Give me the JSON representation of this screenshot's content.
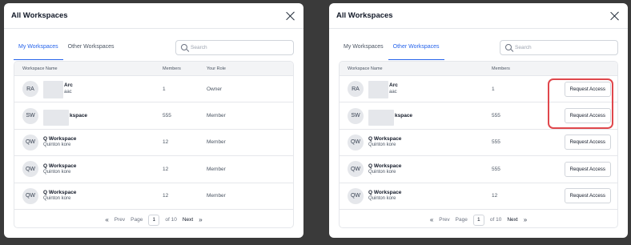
{
  "left": {
    "title": "All Workspaces",
    "tabs": [
      {
        "label": "My Workspaces",
        "active": true
      },
      {
        "label": "Other Workspaces",
        "active": false
      }
    ],
    "search_placeholder": "Search",
    "columns": [
      "Workspace Name",
      "Members",
      "Your Role"
    ],
    "rows": [
      {
        "initials": "RA",
        "name": "Arc",
        "owner": "aac",
        "members": "1",
        "role": "Owner"
      },
      {
        "initials": "SW",
        "name": "kspace",
        "owner": "",
        "members": "555",
        "role": "Member"
      },
      {
        "initials": "QW",
        "name": "Q Workspace",
        "owner": "Quinton kore",
        "members": "12",
        "role": "Member"
      },
      {
        "initials": "QW",
        "name": "Q Workspace",
        "owner": "Quinton kore",
        "members": "12",
        "role": "Member"
      },
      {
        "initials": "QW",
        "name": "Q Workspace",
        "owner": "Quinton kore",
        "members": "12",
        "role": "Member"
      }
    ],
    "pager": {
      "prev": "Prev",
      "page_label": "Page",
      "page": "1",
      "of": "of 10",
      "next": "Next"
    }
  },
  "right": {
    "title": "All Workspaces",
    "tabs": [
      {
        "label": "My Workspaces",
        "active": false
      },
      {
        "label": "Other Workspaces",
        "active": true
      }
    ],
    "search_placeholder": "Search",
    "columns": [
      "Workspace Name",
      "Members"
    ],
    "action_label": "Request Access",
    "rows": [
      {
        "initials": "RA",
        "name": "Arc",
        "owner": "aac",
        "members": "1"
      },
      {
        "initials": "SW",
        "name": "kspace",
        "owner": "",
        "members": "555"
      },
      {
        "initials": "QW",
        "name": "Q Workspace",
        "owner": "Quinton kore",
        "members": "555"
      },
      {
        "initials": "QW",
        "name": "Q Workspace",
        "owner": "Quinton kore",
        "members": "555"
      },
      {
        "initials": "QW",
        "name": "Q Workspace",
        "owner": "Quinton kore",
        "members": "12"
      }
    ],
    "pager": {
      "prev": "Prev",
      "page_label": "Page",
      "page": "1",
      "of": "of 10",
      "next": "Next"
    }
  },
  "colors": {
    "accent": "#2563eb",
    "highlight": "#e0474c",
    "backdrop": "#3a3a3a"
  }
}
